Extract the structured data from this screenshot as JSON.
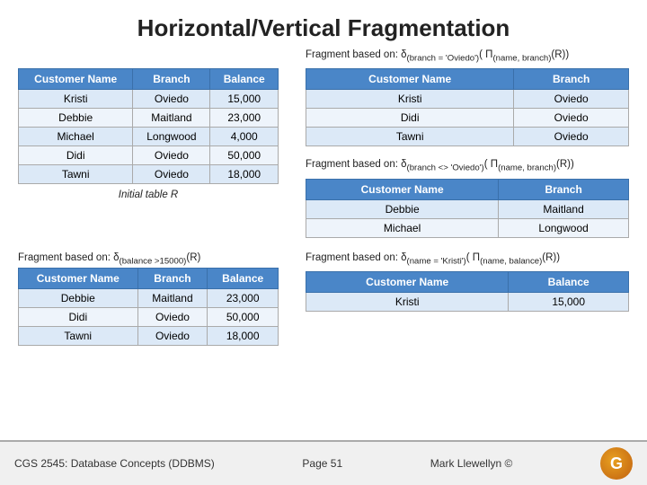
{
  "title": "Horizontal/Vertical Fragmentation",
  "footer": {
    "left": "CGS 2545: Database Concepts  (DDBMS)",
    "center": "Page 51",
    "right": "Mark Llewellyn ©"
  },
  "initial_table": {
    "label": "Initial table R",
    "headers": [
      "Customer Name",
      "Branch",
      "Balance"
    ],
    "rows": [
      [
        "Kristi",
        "Oviedo",
        "15,000"
      ],
      [
        "Debbie",
        "Maitland",
        "23,000"
      ],
      [
        "Michael",
        "Longwood",
        "4,000"
      ],
      [
        "Didi",
        "Oviedo",
        "50,000"
      ],
      [
        "Tawni",
        "Oviedo",
        "18,000"
      ]
    ]
  },
  "fragment1": {
    "label_prefix": "Fragment based on: δ",
    "label_sub": "(branch = 'Oviedo')",
    "label_mid": "( Π",
    "label_sub2": "(name, branch)",
    "label_suffix": "(R))",
    "headers": [
      "Customer Name",
      "Branch"
    ],
    "rows": [
      [
        "Kristi",
        "Oviedo"
      ],
      [
        "Didi",
        "Oviedo"
      ],
      [
        "Tawni",
        "Oviedo"
      ]
    ]
  },
  "fragment2": {
    "label_prefix": "Fragment based on: δ",
    "label_sub": "(branch <> 'Oviedo')",
    "label_mid": "( Π",
    "label_sub2": "(name, branch)",
    "label_suffix": "(R))",
    "headers": [
      "Customer Name",
      "Branch"
    ],
    "rows": [
      [
        "Debbie",
        "Maitland"
      ],
      [
        "Michael",
        "Longwood"
      ]
    ]
  },
  "fragment3": {
    "label_prefix": "Fragment based on: δ",
    "label_sub": "(balance >15000)",
    "label_suffix": "(R)",
    "headers": [
      "Customer Name",
      "Branch",
      "Balance"
    ],
    "rows": [
      [
        "Debbie",
        "Maitland",
        "23,000"
      ],
      [
        "Didi",
        "Oviedo",
        "50,000"
      ],
      [
        "Tawni",
        "Oviedo",
        "18,000"
      ]
    ]
  },
  "fragment4": {
    "label_prefix": "Fragment based on: δ",
    "label_sub": "(name = 'Kristi')",
    "label_mid": "( Π",
    "label_sub2": "(name, balance)",
    "label_suffix": "(R))",
    "headers": [
      "Customer Name",
      "Balance"
    ],
    "rows": [
      [
        "Kristi",
        "15,000"
      ]
    ]
  }
}
